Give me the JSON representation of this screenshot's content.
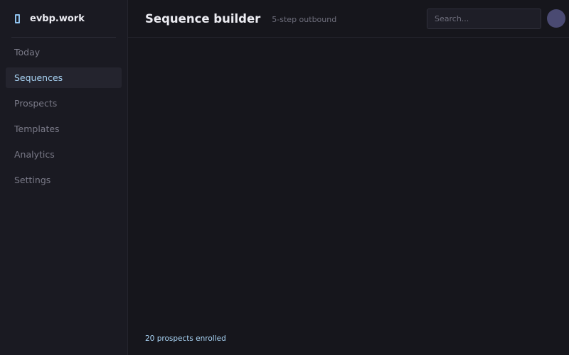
{
  "brand": {
    "name": "evbp.work"
  },
  "sidebar": {
    "items": [
      {
        "label": "Today",
        "active": false
      },
      {
        "label": "Sequences",
        "active": true
      },
      {
        "label": "Prospects",
        "active": false
      },
      {
        "label": "Templates",
        "active": false
      },
      {
        "label": "Analytics",
        "active": false
      },
      {
        "label": "Settings",
        "active": false
      }
    ]
  },
  "header": {
    "title": "Sequence builder",
    "subtitle": "5-step outbound"
  },
  "search": {
    "placeholder": "Search..."
  },
  "footer": {
    "status": "20 prospects enrolled"
  },
  "colors": {
    "accent": "#a9d4f5",
    "background": "#16161c",
    "sidebar": "#1a1a22"
  }
}
